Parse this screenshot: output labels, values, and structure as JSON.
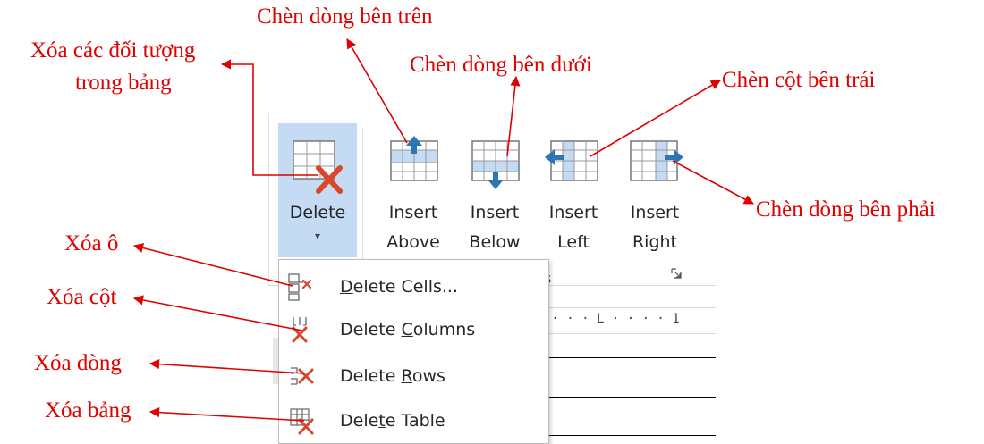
{
  "ribbon": {
    "buttons": {
      "delete": {
        "label": "Delete",
        "caret": "▾"
      },
      "insert_above": {
        "line1": "Insert",
        "line2": "Above"
      },
      "insert_below": {
        "line1": "Insert",
        "line2": "Below"
      },
      "insert_left": {
        "line1": "Insert",
        "line2": "Left"
      },
      "insert_right": {
        "line1": "Insert",
        "line2": "Right"
      }
    },
    "group_name_fragment": "s",
    "dialog_launcher_icon": "dialog-launcher-icon"
  },
  "ruler": {
    "text": " · · · L · · · · 1"
  },
  "delete_menu": {
    "items": [
      {
        "pre": "",
        "key": "D",
        "post": "elete Cells...",
        "icon": "delete-cells-icon"
      },
      {
        "pre": "Delete ",
        "key": "C",
        "post": "olumns",
        "icon": "delete-columns-icon"
      },
      {
        "pre": "Delete ",
        "key": "R",
        "post": "ows",
        "icon": "delete-rows-icon"
      },
      {
        "pre": "Dele",
        "key": "t",
        "post": "e Table",
        "icon": "delete-table-icon"
      }
    ]
  },
  "annotations": {
    "delete_objects_line1": "Xóa các đối tượng",
    "delete_objects_line2": "trong bảng",
    "insert_row_above": "Chèn dòng bên trên",
    "insert_row_below": "Chèn dòng bên dưới",
    "insert_col_left": "Chèn cột bên trái",
    "insert_right": "Chèn dòng bên phải",
    "delete_cell": "Xóa ô",
    "delete_column": "Xóa cột",
    "delete_row": "Xóa dòng",
    "delete_table": "Xóa bảng"
  },
  "colors": {
    "annotation_red": "#e00000",
    "selected_button_bg": "#c5dbf3",
    "icon_blue": "#2e75b6",
    "icon_red_x": "#d9472b"
  }
}
